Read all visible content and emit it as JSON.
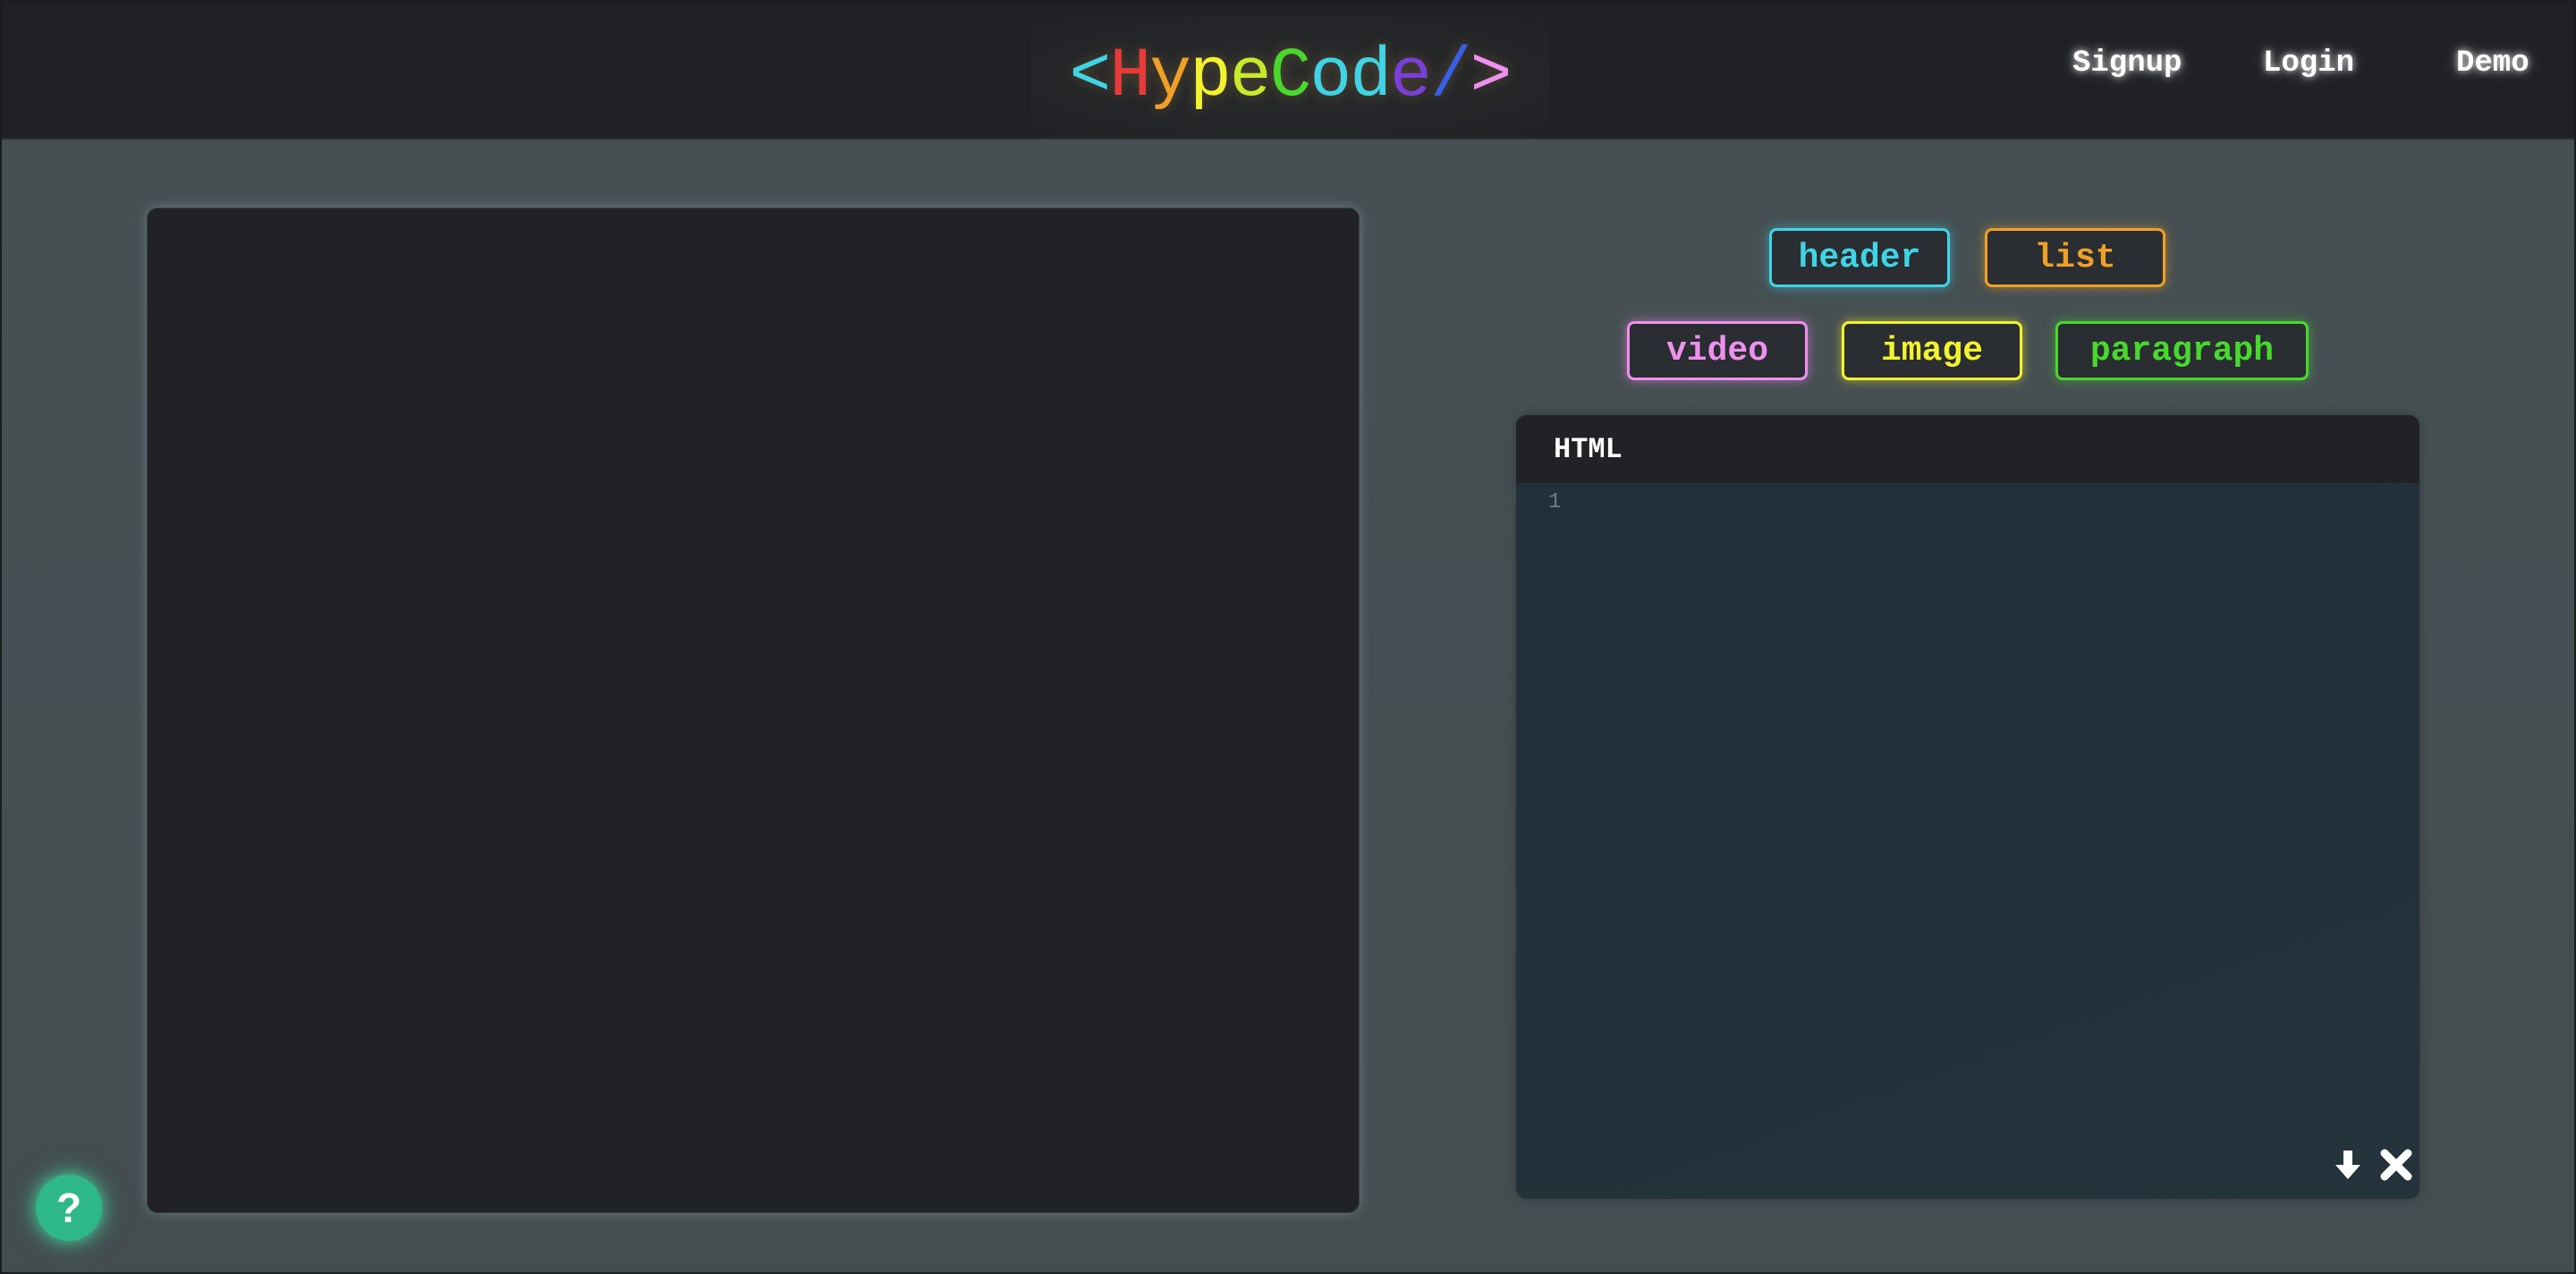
{
  "header": {
    "logo": {
      "parts": [
        {
          "text": "<",
          "color": "#3fd4e6"
        },
        {
          "text": "H",
          "color": "#e93a3a"
        },
        {
          "text": "y",
          "color": "#f0a027"
        },
        {
          "text": "p",
          "color": "#f2f22e"
        },
        {
          "text": "e",
          "color": "#c8ea2a"
        },
        {
          "text": "C",
          "color": "#48d82e"
        },
        {
          "text": "o",
          "color": "#3fd4e6"
        },
        {
          "text": "d",
          "color": "#3fd4e6"
        },
        {
          "text": "e",
          "color": "#7a3fd8"
        },
        {
          "text": "/",
          "color": "#3a5ee8"
        },
        {
          "text": ">",
          "color": "#ee90ee"
        }
      ]
    },
    "nav": {
      "signup": "Signup",
      "login": "Login",
      "demo": "Demo"
    }
  },
  "tags": {
    "header": "header",
    "list": "list",
    "video": "video",
    "image": "image",
    "paragraph": "paragraph"
  },
  "editor": {
    "title": "HTML",
    "line_number": "1",
    "content": "",
    "icons": {
      "download": "download-arrow-icon",
      "clear": "close-x-icon"
    }
  },
  "help": {
    "label": "?",
    "icon": "question-icon",
    "color": "#2eb88a"
  }
}
